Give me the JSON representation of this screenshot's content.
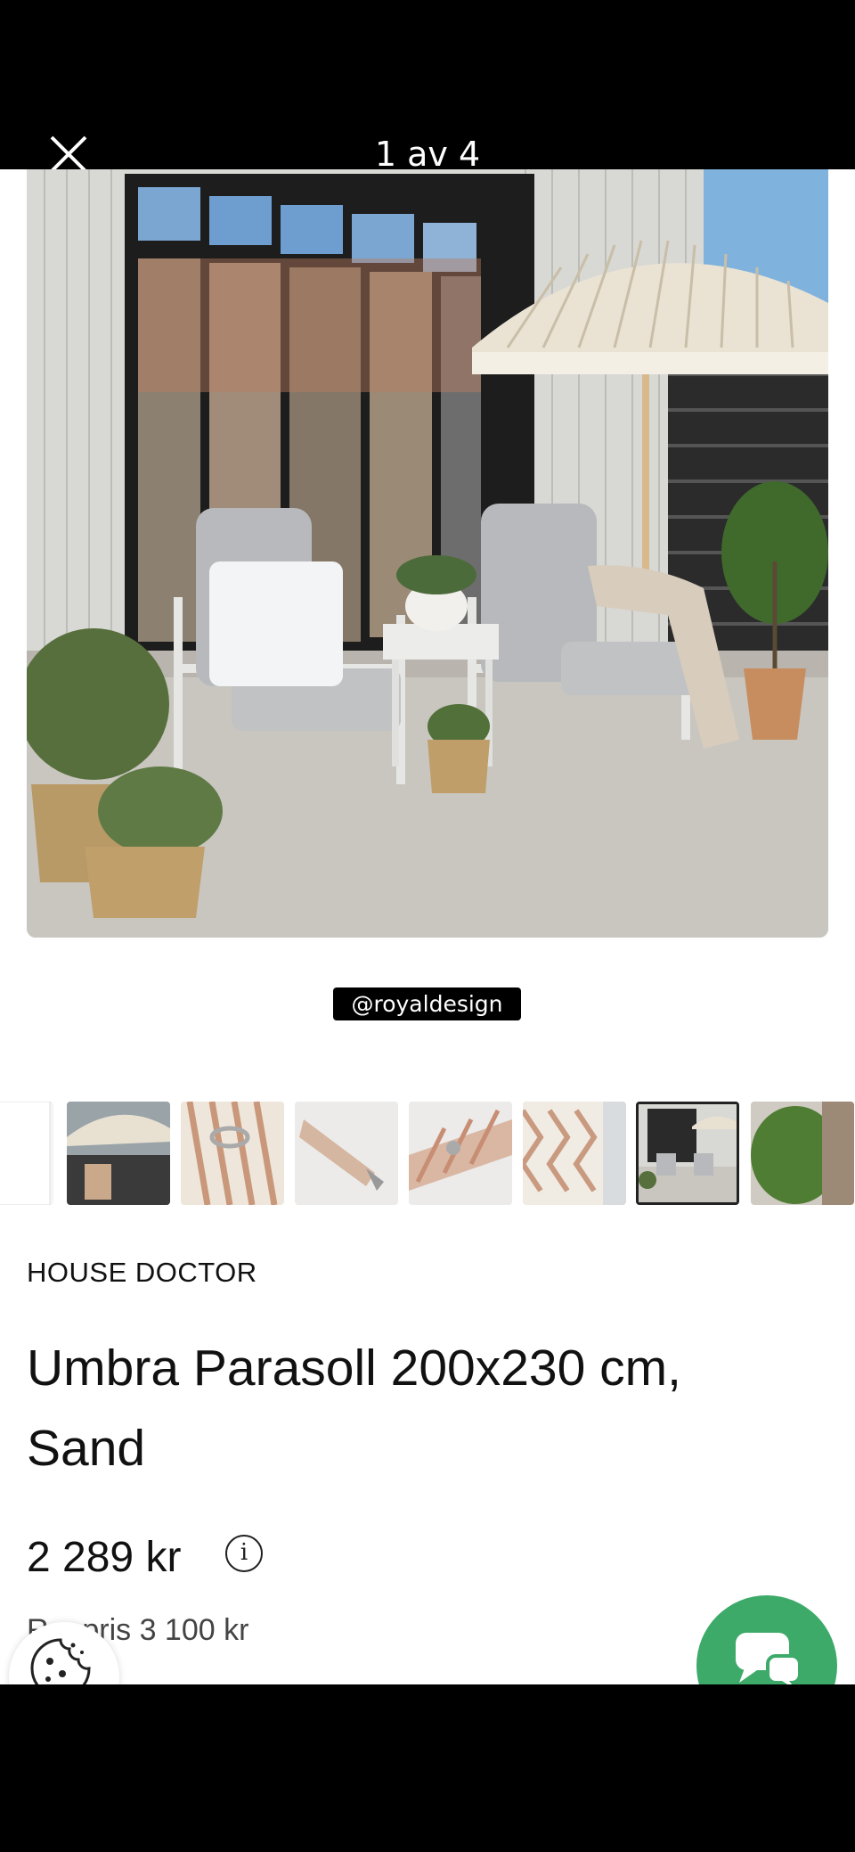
{
  "header": {
    "counter": "1 av 4"
  },
  "image": {
    "credit": "@royaldesign"
  },
  "thumbnails": [
    {
      "name": "thumbnail-white"
    },
    {
      "name": "thumbnail-parasol-lifestyle"
    },
    {
      "name": "thumbnail-fabric-ring"
    },
    {
      "name": "thumbnail-pole-tip"
    },
    {
      "name": "thumbnail-fabric-clip"
    },
    {
      "name": "thumbnail-fringe"
    },
    {
      "name": "thumbnail-patio-selected"
    },
    {
      "name": "thumbnail-plants"
    }
  ],
  "product": {
    "brand": "HOUSE DOCTOR",
    "title": "Umbra Parasoll 200x230 cm, Sand",
    "price": "2 289 kr",
    "info_glyph": "i",
    "reference_price": "R... pris 3 100 kr"
  },
  "colors": {
    "chat_button": "#3daa6a",
    "header_bg": "#000000"
  },
  "icons": [
    "close-icon",
    "info-icon",
    "cookie-icon",
    "chat-icon"
  ]
}
